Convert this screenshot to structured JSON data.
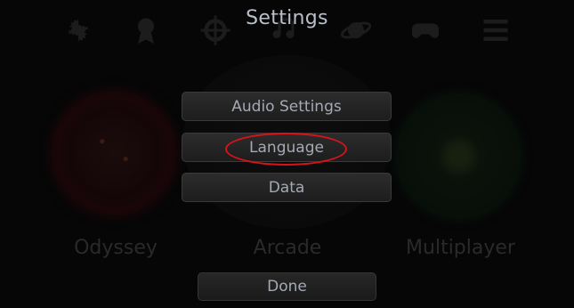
{
  "dialog": {
    "title": "Settings",
    "buttons": [
      {
        "label": "Audio Settings"
      },
      {
        "label": "Language"
      },
      {
        "label": "Data"
      }
    ],
    "done_label": "Done"
  },
  "background": {
    "modes": [
      {
        "label": "Odyssey"
      },
      {
        "label": "Arcade"
      },
      {
        "label": "Multiplayer"
      }
    ],
    "top_icons": [
      "gear-icon",
      "award-icon",
      "crosshair-icon",
      "music-icon",
      "planet-icon",
      "gamepad-icon",
      "list-icon"
    ]
  },
  "annotation": {
    "highlight_color": "#d8141b",
    "highlighted_item": "Language"
  }
}
